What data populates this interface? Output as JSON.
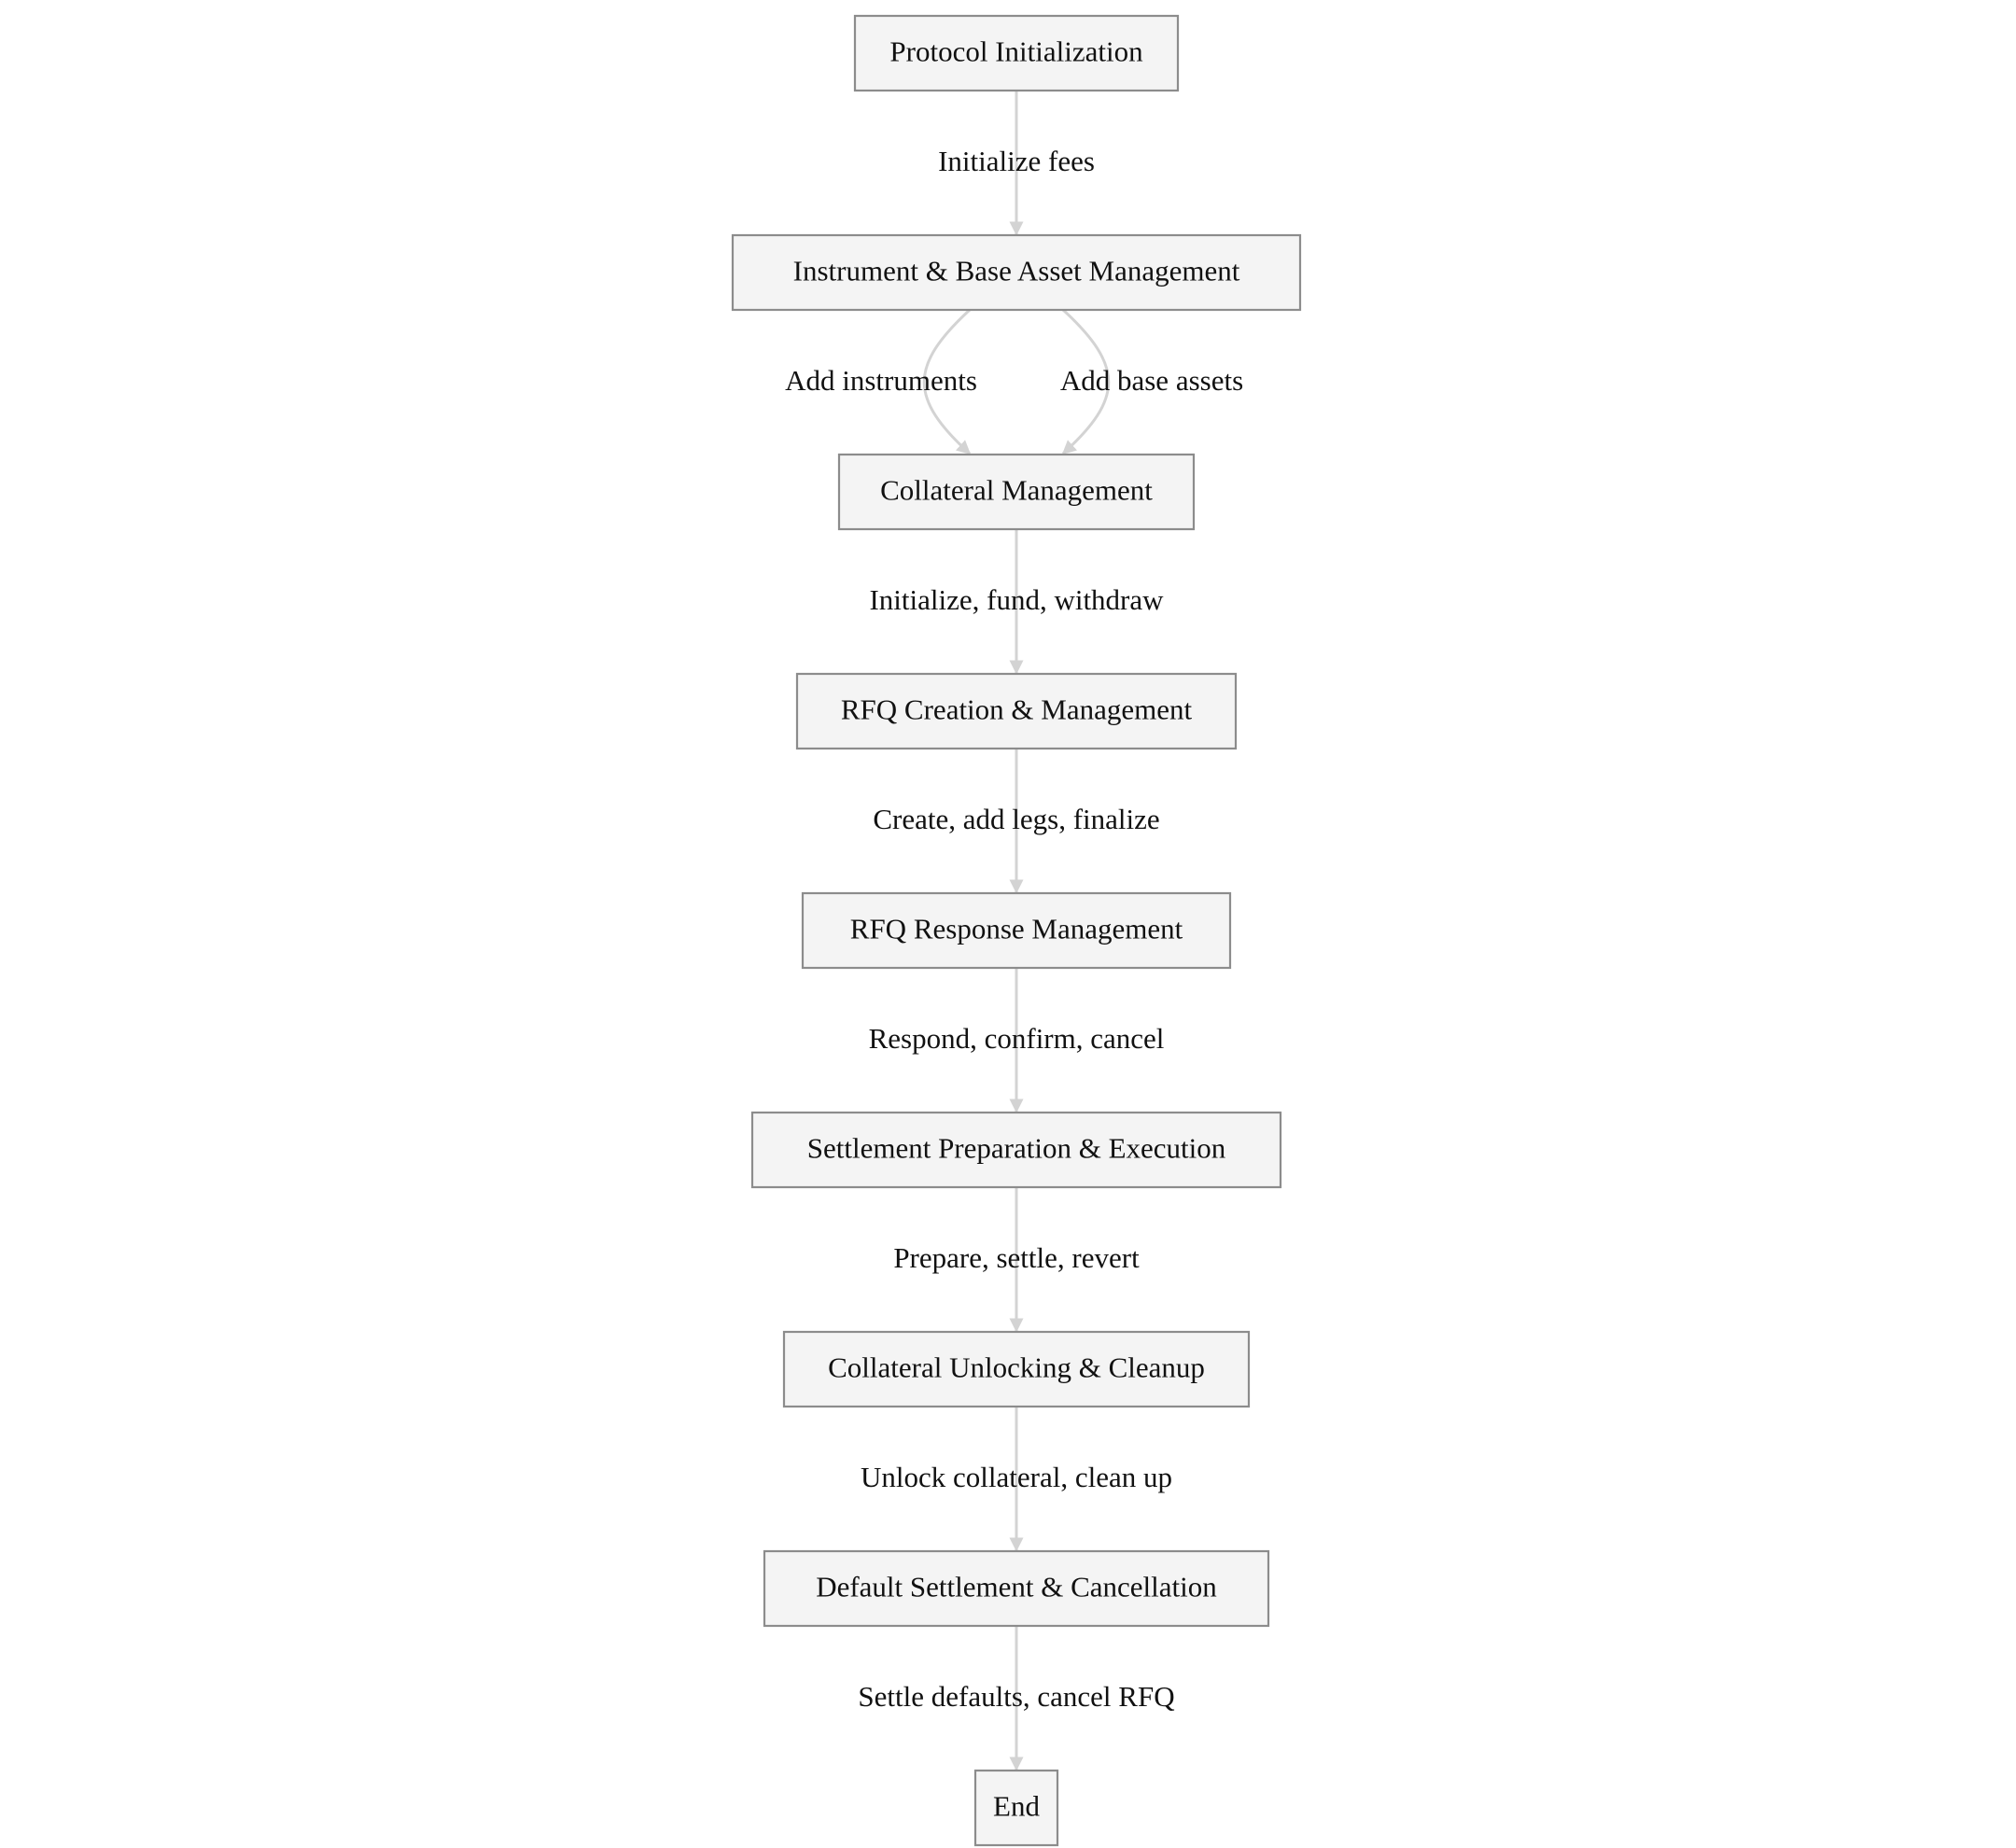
{
  "diagram": {
    "nodes": [
      {
        "id": "n1",
        "label": "Protocol Initialization"
      },
      {
        "id": "n2",
        "label": "Instrument & Base Asset Management"
      },
      {
        "id": "n3",
        "label": "Collateral Management"
      },
      {
        "id": "n4",
        "label": "RFQ Creation & Management"
      },
      {
        "id": "n5",
        "label": "RFQ Response Management"
      },
      {
        "id": "n6",
        "label": "Settlement Preparation & Execution"
      },
      {
        "id": "n7",
        "label": "Collateral Unlocking & Cleanup"
      },
      {
        "id": "n8",
        "label": "Default Settlement & Cancellation"
      },
      {
        "id": "n9",
        "label": "End"
      }
    ],
    "edges": [
      {
        "from": "n1",
        "to": "n2",
        "label": "Initialize fees"
      },
      {
        "from": "n2",
        "to": "n3",
        "label": "Add instruments"
      },
      {
        "from": "n2",
        "to": "n3",
        "label": "Add base assets"
      },
      {
        "from": "n3",
        "to": "n4",
        "label": "Initialize, fund, withdraw"
      },
      {
        "from": "n4",
        "to": "n5",
        "label": "Create, add legs, finalize"
      },
      {
        "from": "n5",
        "to": "n6",
        "label": "Respond, confirm, cancel"
      },
      {
        "from": "n6",
        "to": "n7",
        "label": "Prepare, settle, revert"
      },
      {
        "from": "n7",
        "to": "n8",
        "label": "Unlock collateral, clean up"
      },
      {
        "from": "n8",
        "to": "n9",
        "label": "Settle defaults, cancel RFQ"
      }
    ],
    "colors": {
      "node_fill": "#f4f4f4",
      "node_border": "#8c8c8c",
      "edge": "#d3d3d3",
      "text": "#111111"
    }
  }
}
